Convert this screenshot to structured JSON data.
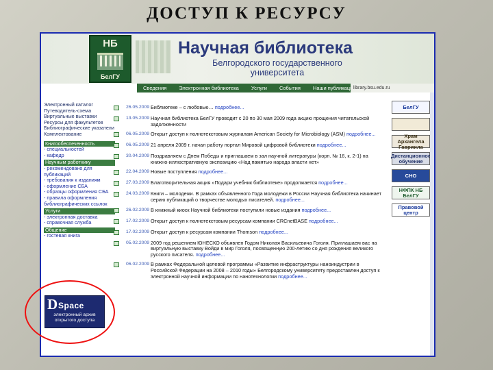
{
  "slide_title": "ДОСТУП К РЕСУРСУ",
  "header": {
    "logo_top": "НБ",
    "logo_bottom": "БелГУ",
    "title": "Научная библиотека",
    "subtitle": "Белгородского государственного университета"
  },
  "nav": {
    "items": [
      "Сведения",
      "Электронная библиотека",
      "Услуги",
      "События",
      "Наши публикации"
    ],
    "url": "library.bsu.edu.ru"
  },
  "sidebar": {
    "items": [
      "Электронный каталог",
      "Путеводитель-схема",
      "Виртуальные выставки",
      "Ресурсы для факультетов",
      "Библиографические указатели",
      "Комплектование"
    ],
    "group1": {
      "header": "Книгообеспеченность",
      "items": [
        "- специальностей",
        "- кафедр"
      ]
    },
    "group2": {
      "header": "Научным работнику",
      "items": [
        "- рекомендовано для публикаций",
        "- требования к изданиям",
        "- оформление СБА",
        "- образцы оформления СБА",
        "- правила оформления библиографических ссылок"
      ]
    },
    "group3": {
      "header": "Услуги",
      "items": [
        "- электронная доставка",
        "- справочная служба"
      ]
    },
    "group4": {
      "header": "Общение",
      "items": [
        "- гостевая книга"
      ]
    }
  },
  "dspace": {
    "logo_d": "D",
    "logo_rest": "Space",
    "caption": "электронный архив открытого доступа"
  },
  "news": [
    {
      "date": "26.05.2009",
      "text": "Библиотеке – с любовью…",
      "more": "подробнее..."
    },
    {
      "date": "13.05.2009",
      "text": "Научная библиотека БелГУ проводит с 20 по 30 мая 2009 года акцию прощения читательской задолженности",
      "more": ""
    },
    {
      "date": "06.05.2009",
      "text": "Открыт доступ к полнотекстовым журналам American Society for Microbiology (ASM)",
      "more": "подробнее..."
    },
    {
      "date": "06.05.2009",
      "text": "21 апреля 2009 г. начал работу портал Мировой цифровой библиотеки",
      "more": "подробнее..."
    },
    {
      "date": "30.04.2009",
      "text": "Поздравляем с Днем Победы и приглашаем в зал научной литературы (корп. № 16, к. 2-1) на книжно-иллюстративную экспозицию «Над памятью народа власти нет»",
      "more": ""
    },
    {
      "date": "22.04.2009",
      "text": "Новые поступления",
      "more": "подробнее..."
    },
    {
      "date": "27.03.2009",
      "text": "Благотворительная акция «Подари учебник библиотеке» продолжается",
      "more": "подробнее..."
    },
    {
      "date": "24.03.2009",
      "text": "Книги – молодежи. В рамках объявленного Года молодежи в России Научная библиотека начинает серию публикаций о творчестве молодых писателей.",
      "more": "подробнее..."
    },
    {
      "date": "26.02.2009",
      "text": "В книжный киоск Научной библиотеки поступили новые издания",
      "more": "подробнее..."
    },
    {
      "date": "17.02.2009",
      "text": "Открыт доступ к полнотекстовым ресурсам компании CRCnetBASE",
      "more": "подробнее..."
    },
    {
      "date": "17.02.2009",
      "text": "Открыт доступ к ресурсам компании Thomson",
      "more": "подробнее..."
    },
    {
      "date": "05.02.2009",
      "text": "2009 год решением ЮНЕСКО объявлен Годом Николая Васильевича Гоголя. Приглашаем вас на виртуальную выставку Войди в мир Гоголя, посвященную 200-летию со дня рождения великого русского писателя.",
      "more": "подробнее..."
    },
    {
      "date": "06.02.2009",
      "text": "В рамках Федеральной целевой программы «Развитие инфраструктуры наноиндустрии в Российской Федерации на 2008 – 2010 годы» Белгородскому университету предоставлен доступ к электронной научной информации по нанотехнологии",
      "more": "подробнее..."
    }
  ],
  "right_badges": [
    {
      "label": "БелГУ",
      "bg": "#f4f6ff",
      "fg": "#1a3a9c"
    },
    {
      "label": "",
      "bg": "#f1ead7",
      "fg": "#5a3a12"
    },
    {
      "label": "Храм Архангела Гавриила",
      "bg": "#efe9dc",
      "fg": "#3a2f16"
    },
    {
      "label": "Дистанционное обучение",
      "bg": "#d9dde7",
      "fg": "#203066"
    },
    {
      "label": "СНО",
      "bg": "#274a9a",
      "fg": "#ffffff"
    },
    {
      "label": "НФПК НБ БелГУ",
      "bg": "#eef5ee",
      "fg": "#1d5a2c"
    },
    {
      "label": "Правовой центр",
      "bg": "#ffffff",
      "fg": "#1a3a9c"
    }
  ]
}
